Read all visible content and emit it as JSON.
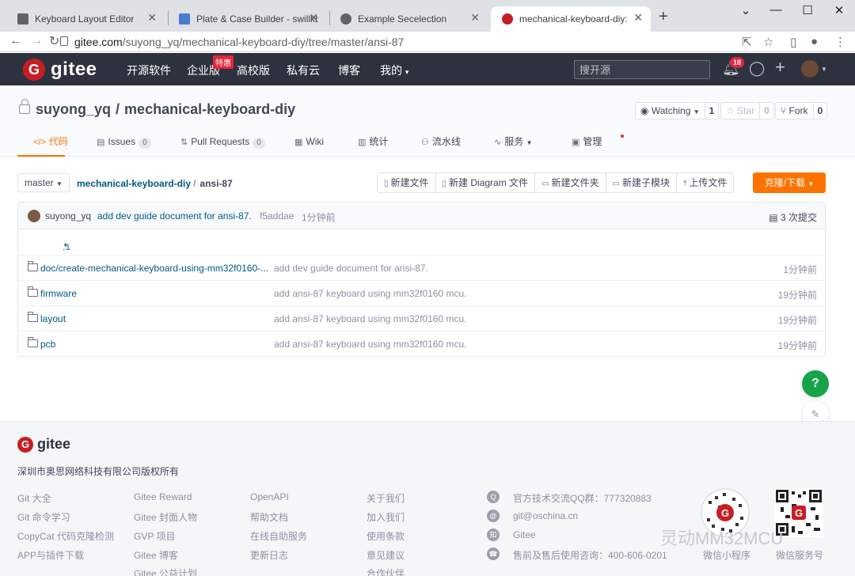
{
  "browser": {
    "tabs": [
      {
        "title": "Keyboard Layout Editor",
        "favicon_color": "#5f6368",
        "active": false
      },
      {
        "title": "Plate & Case Builder - swillkb",
        "favicon_color": "#4a7bd0",
        "active": false
      },
      {
        "title": "Example Secelection",
        "favicon_color": "#5f6368",
        "active": false
      },
      {
        "title": "mechanical-keyboard-diy: DIY",
        "favicon_color": "#c71d23",
        "active": true
      }
    ],
    "url_host": "gitee.com",
    "url_path": "/suyong_yq/mechanical-keyboard-diy/tree/master/ansi-87"
  },
  "gitee_header": {
    "logo_letter": "G",
    "logo_text": "gitee",
    "nav": [
      "开源软件",
      "企业版",
      "高校版",
      "私有云",
      "博客",
      "我的"
    ],
    "enterprise_badge": "特惠",
    "search_placeholder": "搜开源",
    "notification_count": "18"
  },
  "repo": {
    "owner": "suyong_yq",
    "separator": "/",
    "name": "mechanical-keyboard-diy",
    "watching_label": "Watching",
    "watching_count": "1",
    "star_label": "Star",
    "star_count": "0",
    "fork_label": "Fork",
    "fork_count": "0",
    "tabs": [
      {
        "icon": "</>",
        "label": "代码"
      },
      {
        "icon": "▤",
        "label": "Issues",
        "count": "0"
      },
      {
        "icon": "⇅",
        "label": "Pull Requests",
        "count": "0"
      },
      {
        "icon": "▦",
        "label": "Wiki"
      },
      {
        "icon": "▥",
        "label": "统计"
      },
      {
        "icon": "⚇",
        "label": "流水线"
      },
      {
        "icon": "∿",
        "label": "服务"
      },
      {
        "icon": "▣",
        "label": "管理"
      }
    ]
  },
  "toolbar": {
    "branch": "master",
    "breadcrumb_repo": "mechanical-keyboard-diy",
    "breadcrumb_sep": "/",
    "breadcrumb_current": "ansi-87",
    "buttons": [
      "新建文件",
      "新建 Diagram 文件",
      "新建文件夹",
      "新建子模块",
      "上传文件"
    ],
    "clone_label": "克隆/下载"
  },
  "commit": {
    "author": "suyong_yq",
    "message": "add dev guide document for ansi-87.",
    "hash": "f5addae",
    "time": "1分钟前",
    "count_label": "3 次提交"
  },
  "back_label": "...",
  "files": [
    {
      "name": "doc/create-mechanical-keyboard-using-mm32f0160-...",
      "message": "add dev guide document for ansi-87.",
      "time": "1分钟前"
    },
    {
      "name": "firmware",
      "message": "add ansi-87 keyboard using mm32f0160 mcu.",
      "time": "19分钟前"
    },
    {
      "name": "layout",
      "message": "add ansi-87 keyboard using mm32f0160 mcu.",
      "time": "19分钟前"
    },
    {
      "name": "pcb",
      "message": "add ansi-87 keyboard using mm32f0160 mcu.",
      "time": "19分钟前"
    }
  ],
  "footer": {
    "logo_text": "gitee",
    "copyright": "深圳市奥思网络科技有限公司版权所有",
    "col1": [
      "Git 大全",
      "Git 命令学习",
      "CopyCat 代码克隆检测",
      "APP与插件下载"
    ],
    "col2": [
      "Gitee Reward",
      "Gitee 封面人物",
      "GVP 项目",
      "Gitee 博客",
      "Gitee 公益计划"
    ],
    "col3": [
      "OpenAPI",
      "帮助文档",
      "在线自助服务",
      "更新日志"
    ],
    "col4": [
      "关于我们",
      "加入我们",
      "使用条款",
      "意见建议",
      "合作伙伴"
    ],
    "contacts": [
      {
        "icon": "Q",
        "text": "官方技术交流QQ群：777320883"
      },
      {
        "icon": "@",
        "text": "git@oschina.cn"
      },
      {
        "icon": "知",
        "text": "Gitee"
      },
      {
        "icon": "☎",
        "text": "售前及售后使用咨询：400-606-0201"
      }
    ],
    "qr_labels": [
      "微信小程序",
      "微信服务号"
    ],
    "watermark": "灵动MM32MCU"
  }
}
